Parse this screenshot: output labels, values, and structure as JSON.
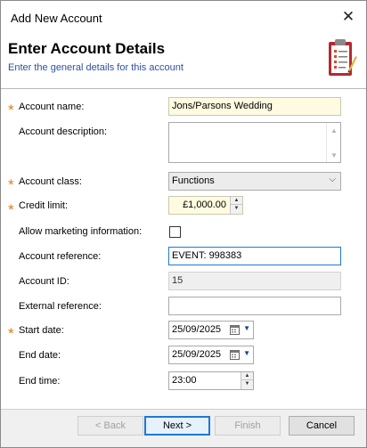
{
  "window": {
    "title": "Add New Account",
    "close_glyph": "✕"
  },
  "header": {
    "title": "Enter Account Details",
    "subtitle": "Enter the general details for this account",
    "icon": "clipboard-checklist-icon"
  },
  "form": {
    "required_marker": "*",
    "account_name": {
      "label": "Account name:",
      "value": "Jons/Parsons Wedding",
      "required": true
    },
    "account_description": {
      "label": "Account description:",
      "value": ""
    },
    "account_class": {
      "label": "Account class:",
      "value": "Functions",
      "required": true
    },
    "credit_limit": {
      "label": "Credit limit:",
      "value": "£1,000.00",
      "required": true
    },
    "allow_marketing": {
      "label": "Allow marketing information:",
      "checked": false
    },
    "account_reference": {
      "label": "Account reference:",
      "value": "EVENT: 998383"
    },
    "account_id": {
      "label": "Account ID:",
      "value": "15"
    },
    "external_reference": {
      "label": "External reference:",
      "value": ""
    },
    "start_date": {
      "label": "Start date:",
      "value": "25/09/2025",
      "required": true
    },
    "end_date": {
      "label": "End date:",
      "value": "25/09/2025"
    },
    "end_time": {
      "label": "End time:",
      "value": "23:00"
    }
  },
  "buttons": {
    "back": "< Back",
    "next": "Next >",
    "finish": "Finish",
    "cancel": "Cancel"
  },
  "colors": {
    "required_asterisk": "#e07a1a",
    "subtitle_text": "#2e4fa3",
    "focus_border": "#1e78d4",
    "highlight_field": "#fffbe0"
  }
}
